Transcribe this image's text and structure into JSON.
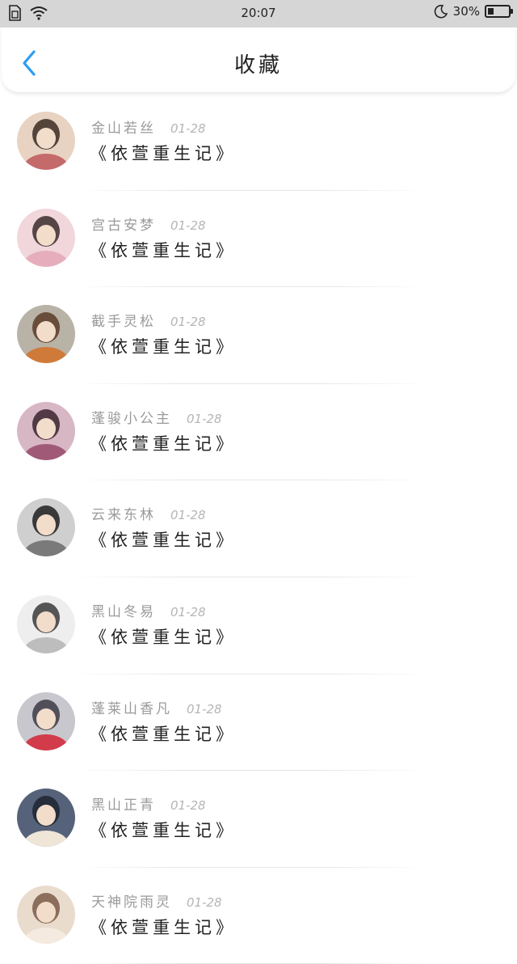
{
  "status_bar": {
    "time": "20:07",
    "battery_percent": "30%",
    "battery_level": 0.3,
    "icons": [
      "sim-icon",
      "wifi-icon",
      "moon-icon",
      "battery-icon"
    ]
  },
  "header": {
    "title": "收藏",
    "back_icon": "chevron-left-icon",
    "accent_color": "#2a9df4"
  },
  "favorites": [
    {
      "name": "金山若丝",
      "date": "01-28",
      "book": "《依萱重生记》",
      "avatar_colors": [
        "#e8d3c2",
        "#3a2a22",
        "#c46a6a"
      ]
    },
    {
      "name": "宫古安梦",
      "date": "01-28",
      "book": "《依萱重生记》",
      "avatar_colors": [
        "#f1d6dc",
        "#3b2c2c",
        "#e6aebc"
      ]
    },
    {
      "name": "截手灵松",
      "date": "01-28",
      "book": "《依萱重生记》",
      "avatar_colors": [
        "#b9b2a6",
        "#5b3a26",
        "#d07a3a"
      ]
    },
    {
      "name": "蓬骏小公主",
      "date": "01-28",
      "book": "《依萱重生记》",
      "avatar_colors": [
        "#d8b7c4",
        "#3a2430",
        "#a05a78"
      ]
    },
    {
      "name": "云来东林",
      "date": "01-28",
      "book": "《依萱重生记》",
      "avatar_colors": [
        "#cfcfcf",
        "#1e1e1e",
        "#7a7a7a"
      ]
    },
    {
      "name": "黑山冬易",
      "date": "01-28",
      "book": "《依萱重生记》",
      "avatar_colors": [
        "#eeeeee",
        "#3a3a3a",
        "#bdbdbd"
      ]
    },
    {
      "name": "蓬莱山香凡",
      "date": "01-28",
      "book": "《依萱重生记》",
      "avatar_colors": [
        "#c9c7ce",
        "#3c3a44",
        "#d23b4a"
      ]
    },
    {
      "name": "黑山正青",
      "date": "01-28",
      "book": "《依萱重生记》",
      "avatar_colors": [
        "#55627a",
        "#1f2430",
        "#f0e6d8"
      ]
    },
    {
      "name": "天神院雨灵",
      "date": "01-28",
      "book": "《依萱重生记》",
      "avatar_colors": [
        "#e9dccd",
        "#7a5b46",
        "#f5eadf"
      ]
    }
  ]
}
